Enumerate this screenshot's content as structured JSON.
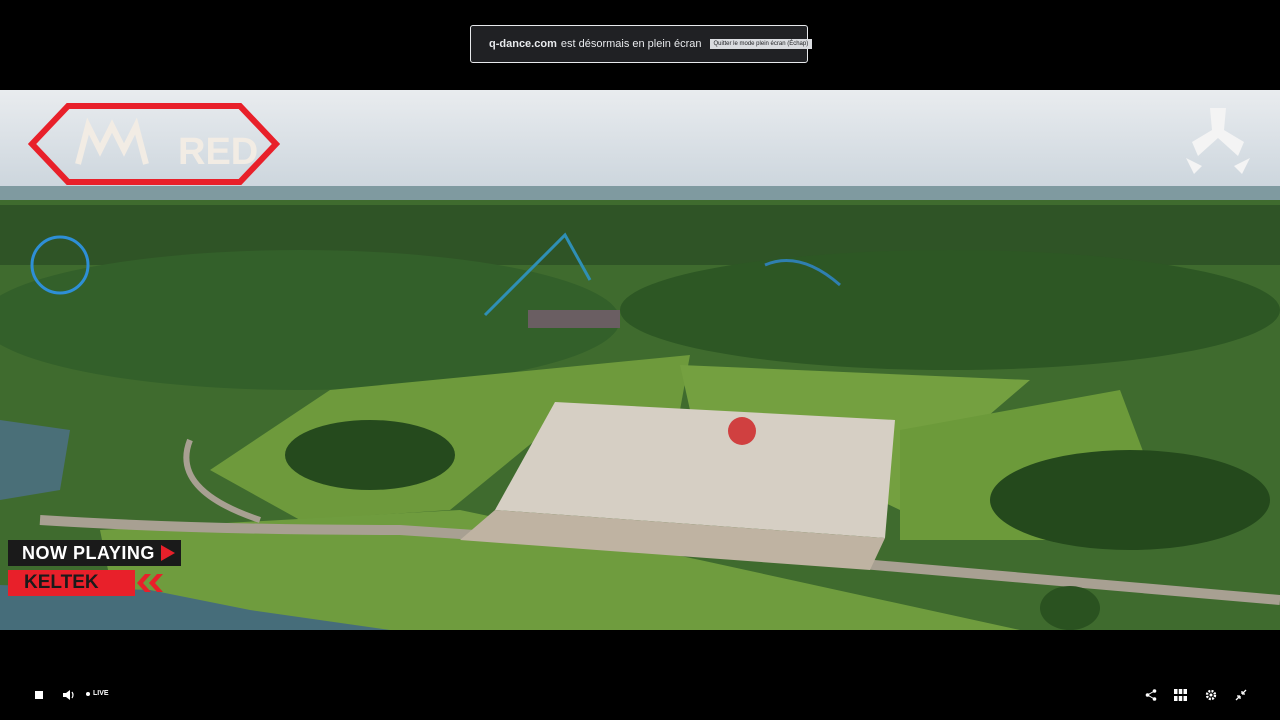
{
  "fullscreen_notice": {
    "domain": "q-dance.com",
    "message": "est désormais en plein écran",
    "exit_label": "Quitter le mode plein écran (Échap)"
  },
  "overlay": {
    "logo_text": "RED",
    "now_playing_label": "NOW PLAYING",
    "artist": "KELTEK"
  },
  "controls": {
    "live_label": "LIVE",
    "icons": [
      "stop-icon",
      "volume-icon",
      "share-icon",
      "grid-icon",
      "settings-icon",
      "exit-fullscreen-icon"
    ]
  },
  "colors": {
    "accent_red": "#e8202a",
    "notice_bg": "#202124"
  }
}
